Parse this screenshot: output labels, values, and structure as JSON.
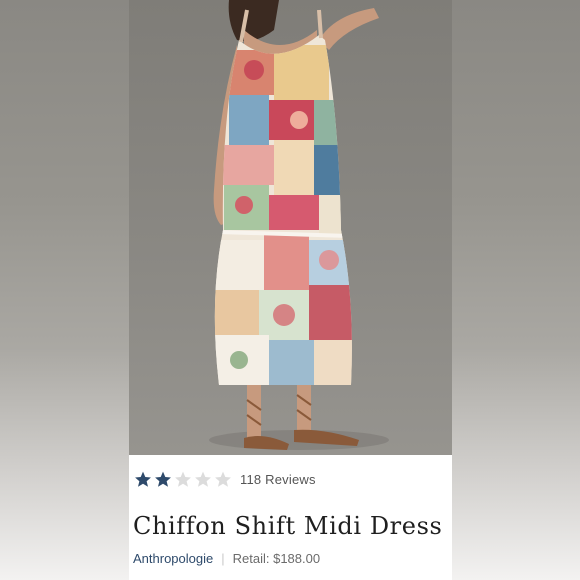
{
  "product": {
    "rating": {
      "filled_stars": 2,
      "total_stars": 5,
      "reviews_text": "118 Reviews"
    },
    "title": "Chiffon Shift Midi Dress",
    "brand": "Anthropologie",
    "separator": "|",
    "retail_price": "Retail: $188.00"
  },
  "colors": {
    "star_filled": "#2e4a6b",
    "star_empty": "#dcdcdc",
    "brand_text": "#2e4a6b"
  }
}
